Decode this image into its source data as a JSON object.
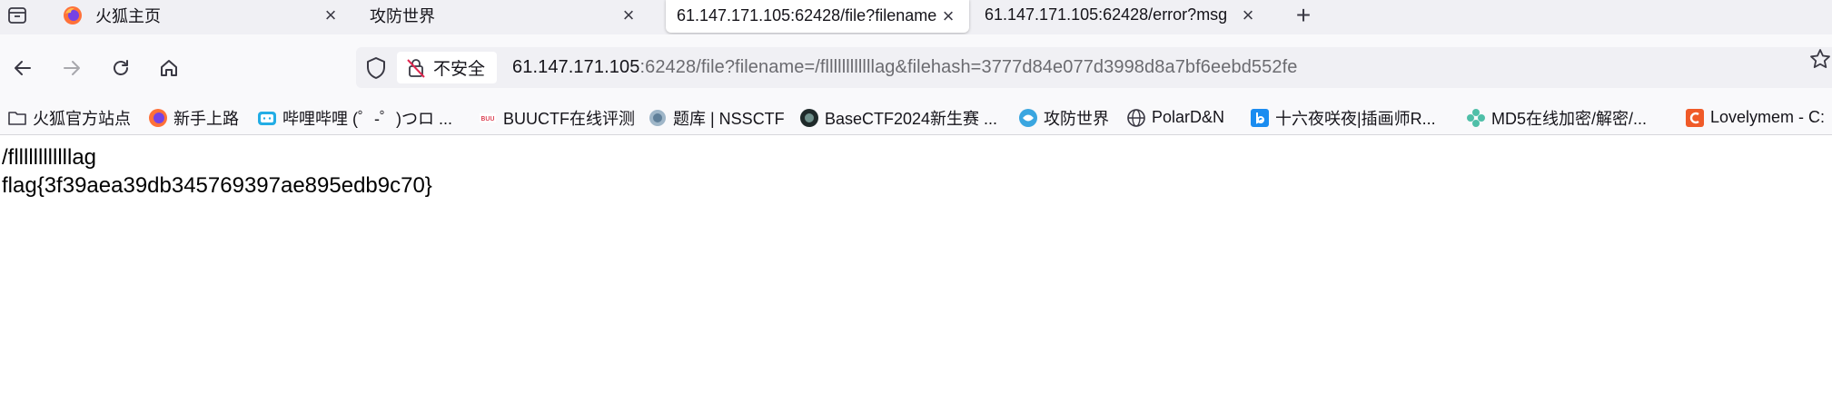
{
  "tabs": [
    {
      "label": "",
      "icon": "tab-list-icon"
    },
    {
      "label": "火狐主页",
      "icon": "firefox-icon"
    },
    {
      "label": "攻防世界",
      "icon": ""
    },
    {
      "label": "61.147.171.105:62428/file?filename",
      "icon": ""
    },
    {
      "label": "61.147.171.105:62428/error?msg",
      "icon": ""
    }
  ],
  "urlbar": {
    "security_label": "不安全",
    "host": "61.147.171.105",
    "rest": ":62428/file?filename=/fllllllllllllag&filehash=3777d84e077d3998d8a7bf6eebd552fe"
  },
  "bookmarks": [
    {
      "label": "火狐官方站点",
      "icon": "folder-icon"
    },
    {
      "label": "新手上路",
      "icon": "firefox-icon"
    },
    {
      "label": "哔哩哔哩 (゜-゜)つロ ...",
      "icon": "bilibili-icon"
    },
    {
      "label": "BUUCTF在线评测",
      "icon": "buuctf-icon"
    },
    {
      "label": "题库 | NSSCTF",
      "icon": "nssctf-icon"
    },
    {
      "label": "BaseCTF2024新生赛 ...",
      "icon": "basectf-icon"
    },
    {
      "label": "攻防世界",
      "icon": "adworld-icon"
    },
    {
      "label": "PolarD&N",
      "icon": "globe-icon"
    },
    {
      "label": "十六夜咲夜|插画师R...",
      "icon": "bing-icon"
    },
    {
      "label": "MD5在线加密/解密/...",
      "icon": "md5-icon"
    },
    {
      "label": "Lovelymem - C:",
      "icon": "lovelymem-icon"
    }
  ],
  "content": {
    "line1": "/fllllllllllllag",
    "line2": "flag{3f39aea39db345769397ae895edb9c70}"
  },
  "colors": {
    "tabbar_bg": "#f0f0f4",
    "toolbar_bg": "#f9f9fb",
    "url_rest": "#6b6b70"
  }
}
